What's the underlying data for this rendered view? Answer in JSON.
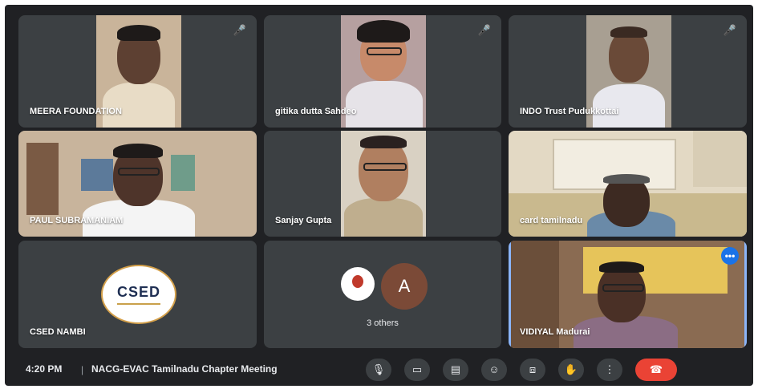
{
  "tiles": [
    {
      "name": "MEERA FOUNDATION",
      "muted": true
    },
    {
      "name": "gitika dutta Sahdeo",
      "muted": true
    },
    {
      "name": "INDO Trust Pudukkottai",
      "muted": true
    },
    {
      "name": "PAUL SUBRAMANIAM",
      "muted": false
    },
    {
      "name": "Sanjay Gupta",
      "muted": false
    },
    {
      "name": "card tamilnadu",
      "muted": false
    },
    {
      "name": "CSED NAMBI",
      "logo_text": "CSED",
      "muted": false
    },
    {
      "name": "",
      "avatar_letter": "A",
      "others_label": "3 others",
      "muted": false
    },
    {
      "name": "VIDIYAL Madurai",
      "muted": false,
      "speaking": true
    }
  ],
  "bottom_bar": {
    "time": "4:20 PM",
    "separator": "|",
    "meeting_title": "NACG-EVAC Tamilnadu Chapter Meeting",
    "controls": [
      {
        "name": "microphone",
        "glyph": "🎙"
      },
      {
        "name": "camera",
        "glyph": "▭"
      },
      {
        "name": "captions",
        "glyph": "▤"
      },
      {
        "name": "emoji",
        "glyph": "☺"
      },
      {
        "name": "present",
        "glyph": "⧈"
      },
      {
        "name": "raise-hand",
        "glyph": "✋"
      },
      {
        "name": "more-options",
        "glyph": "⋮"
      },
      {
        "name": "leave-call",
        "glyph": "☎"
      }
    ]
  },
  "icons": {
    "mic_off": "🎤",
    "speaking": "•••"
  },
  "colors": {
    "background": "#202124",
    "tile": "#3c4043",
    "accent": "#8ab4f8",
    "hangup": "#ea4335"
  }
}
